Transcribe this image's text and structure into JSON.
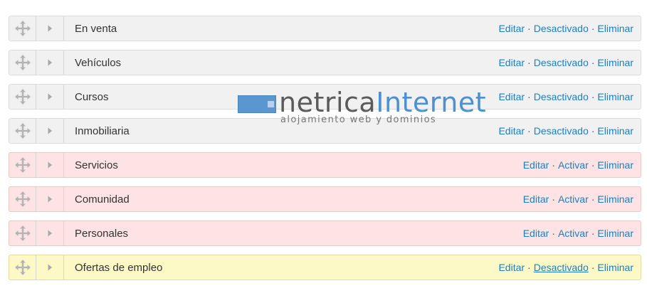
{
  "categories": [
    {
      "name": "En venta",
      "status": "active",
      "actions": [
        "Editar",
        "Desactivado",
        "Eliminar"
      ]
    },
    {
      "name": "Vehículos",
      "status": "active",
      "actions": [
        "Editar",
        "Desactivado",
        "Eliminar"
      ]
    },
    {
      "name": "Cursos",
      "status": "active",
      "actions": [
        "Editar",
        "Desactivado",
        "Eliminar"
      ]
    },
    {
      "name": "Inmobiliaria",
      "status": "active",
      "actions": [
        "Editar",
        "Desactivado",
        "Eliminar"
      ]
    },
    {
      "name": "Servicios",
      "status": "inactive",
      "actions": [
        "Editar",
        "Activar",
        "Eliminar"
      ]
    },
    {
      "name": "Comunidad",
      "status": "inactive",
      "actions": [
        "Editar",
        "Activar",
        "Eliminar"
      ]
    },
    {
      "name": "Personales",
      "status": "inactive",
      "actions": [
        "Editar",
        "Activar",
        "Eliminar"
      ]
    },
    {
      "name": "Ofertas de empleo",
      "status": "highlight",
      "actions": [
        "Editar",
        "Desactivado",
        "Eliminar"
      ],
      "hovered_action": "Desactivado"
    }
  ],
  "separator": "·",
  "watermark": {
    "brand_part1": "netrica",
    "brand_part2": "Internet",
    "tagline": "alojamiento web y dominios"
  },
  "colors": {
    "active_row": "#f1f1f1",
    "inactive_row": "#fde3e3",
    "highlight_row": "#fdf9c7",
    "link": "#1a7fc1",
    "brand_blue": "#5a96cf"
  },
  "icons": {
    "handle": "move-arrows-icon",
    "toggle": "caret-right-icon"
  }
}
